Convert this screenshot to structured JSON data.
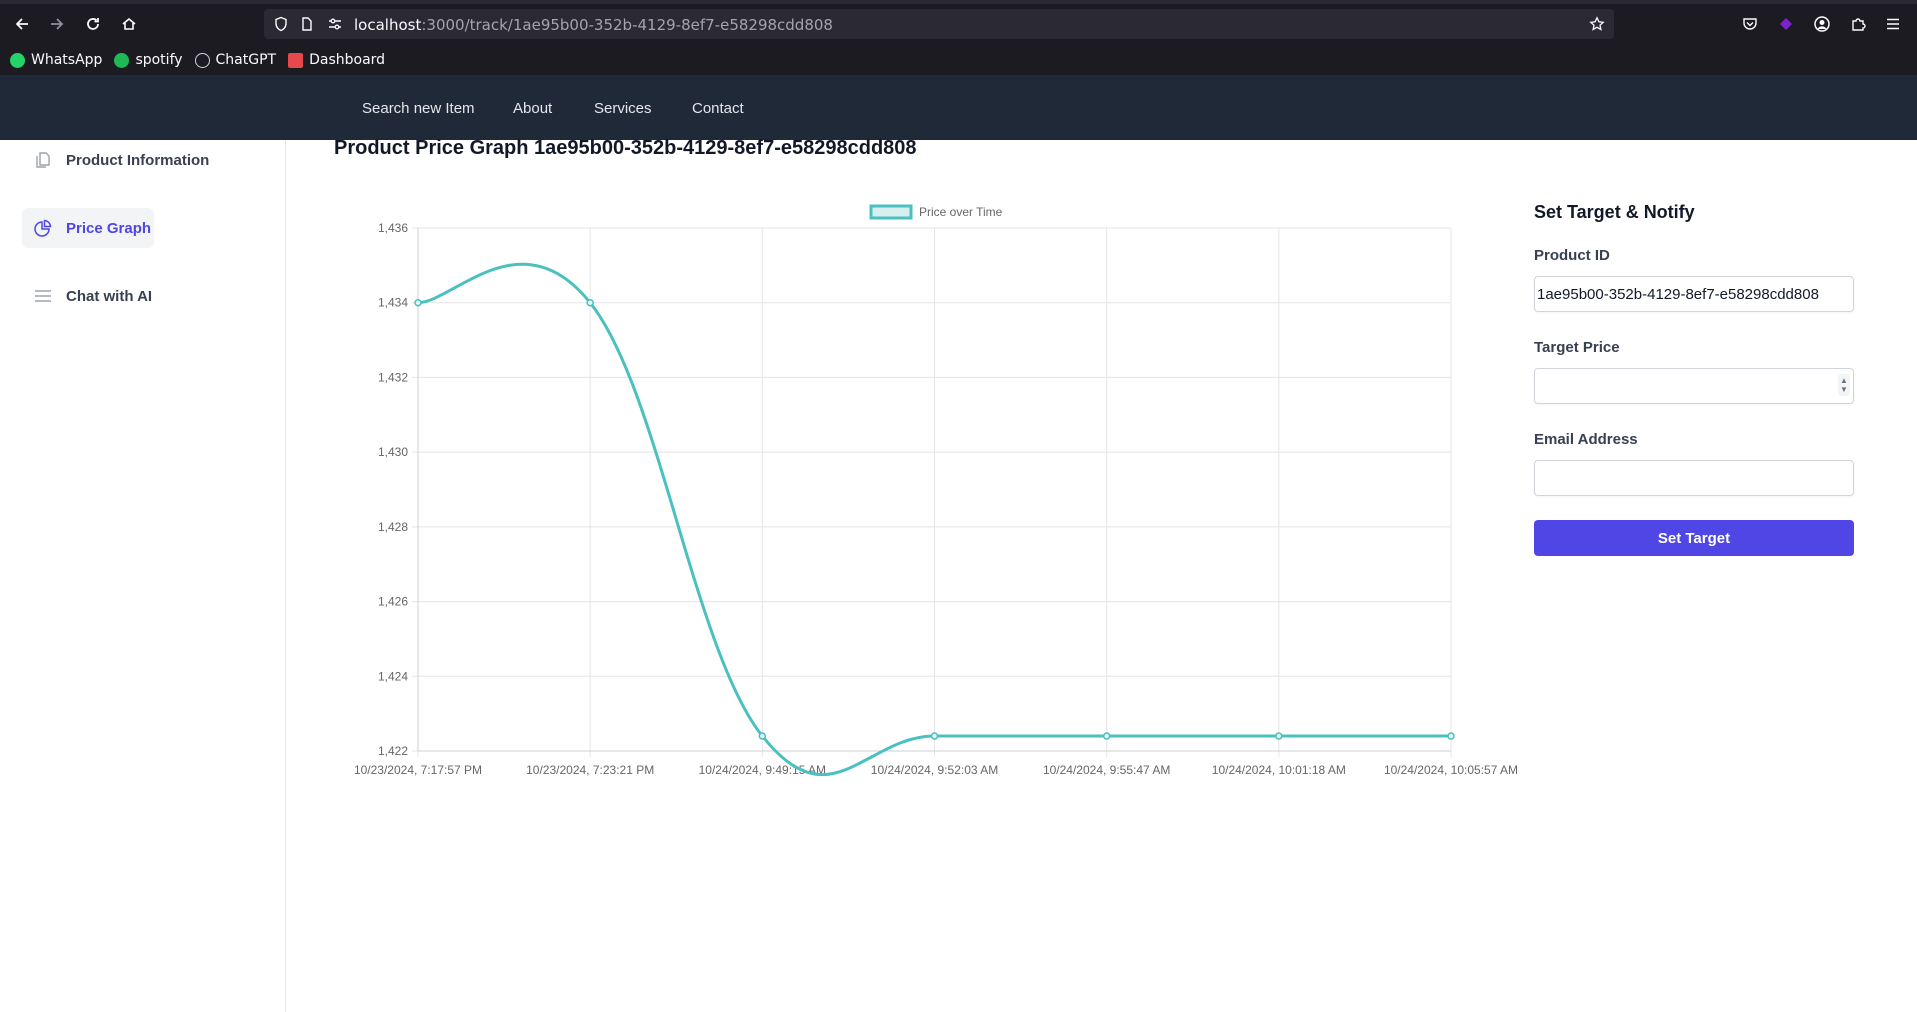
{
  "browser": {
    "url_host": "localhost",
    "url_path": ":3000/track/1ae95b00-352b-4129-8ef7-e58298cdd808",
    "bookmarks": [
      {
        "label": "WhatsApp",
        "color": "#25d366"
      },
      {
        "label": "spotify",
        "color": "#1db954"
      },
      {
        "label": "ChatGPT",
        "color": "#d1d5db"
      },
      {
        "label": "Dashboard",
        "color": "#e5484d"
      }
    ]
  },
  "navbar": {
    "links": [
      "Search new Item",
      "About",
      "Services",
      "Contact"
    ]
  },
  "sidebar": {
    "items": [
      {
        "label": "Product Information",
        "icon": "document-icon",
        "active": false
      },
      {
        "label": "Price Graph",
        "icon": "pie-chart-icon",
        "active": true
      },
      {
        "label": "Chat with AI",
        "icon": "menu-lines-icon",
        "active": false
      }
    ]
  },
  "main": {
    "title": "Product Price Graph 1ae95b00-352b-4129-8ef7-e58298cdd808"
  },
  "form": {
    "title": "Set Target & Notify",
    "product_id_label": "Product ID",
    "product_id_value": "1ae95b00-352b-4129-8ef7-e58298cdd808",
    "target_price_label": "Target Price",
    "target_price_value": "",
    "email_label": "Email Address",
    "email_value": "",
    "submit_label": "Set Target"
  },
  "colors": {
    "accent": "#4f46e5",
    "line": "#4bc0c0",
    "navbar": "#1f2937"
  },
  "chart_data": {
    "type": "line",
    "legend": "top",
    "grid": true,
    "series": [
      {
        "name": "Price over Time",
        "values": [
          1434,
          1434,
          1422.4,
          1422.4,
          1422.4,
          1422.4,
          1422.4
        ]
      }
    ],
    "categories": [
      "10/23/2024, 7:17:57 PM",
      "10/23/2024, 7:23:21 PM",
      "10/24/2024, 9:49:15 AM",
      "10/24/2024, 9:52:03 AM",
      "10/24/2024, 9:55:47 AM",
      "10/24/2024, 10:01:18 AM",
      "10/24/2024, 10:05:57 AM"
    ],
    "ylim": [
      1422,
      1436
    ],
    "yticks": [
      "1,422",
      "1,424",
      "1,426",
      "1,428",
      "1,430",
      "1,432",
      "1,434",
      "1,436"
    ],
    "title": "",
    "xlabel": "",
    "ylabel": ""
  }
}
